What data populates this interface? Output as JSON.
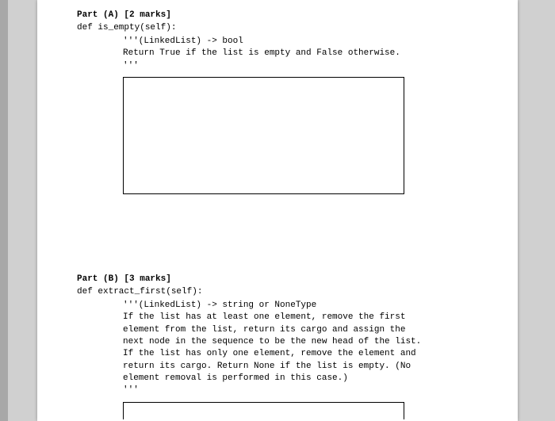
{
  "partA": {
    "header": "Part (A) [2 marks]",
    "def": "def is_empty(self):",
    "doc1": "'''(LinkedList) -> bool",
    "doc2": "Return True if the list is empty and False otherwise.",
    "doc3": "'''"
  },
  "partB": {
    "header": "Part (B) [3 marks]",
    "def": "def extract_first(self):",
    "doc1": "'''(LinkedList) -> string or NoneType",
    "doc2": "If the list has at least one element, remove the first",
    "doc3": "element from the list, return its cargo and assign the",
    "doc4": "next node in the sequence to be the new head of the list.",
    "doc5": "If the list has only one element, remove the element and",
    "doc6": "return its cargo. Return None if the list is empty. (No",
    "doc7": "element removal is performed in this case.)",
    "doc8": "'''"
  }
}
